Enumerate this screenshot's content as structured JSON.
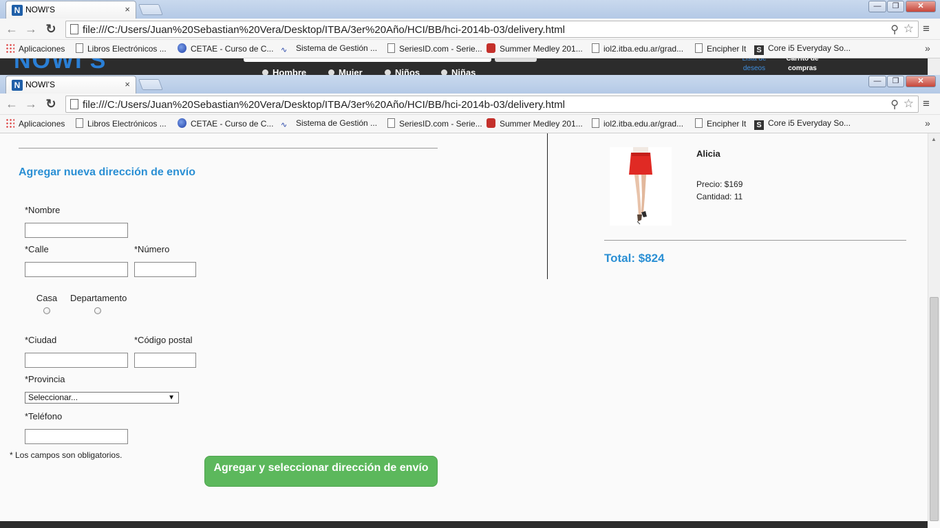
{
  "browser": {
    "tab_title": "NOWI'S",
    "tab_favicon_letter": "N",
    "tab_close": "×",
    "url": "file:///C:/Users/Juan%20Sebastian%20Vera/Desktop/ITBA/3er%20Año/HCI/BB/hci-2014b-03/delivery.html",
    "menu_glyph": "≡",
    "bookmarks": [
      {
        "label": "Aplicaciones",
        "icon": "apps-icon"
      },
      {
        "label": "Libros Electrónicos ...",
        "icon": "page-icon"
      },
      {
        "label": "CETAE - Curso de C...",
        "icon": "globe-icon"
      },
      {
        "label": "Sistema de Gestión ...",
        "icon": "wave-icon"
      },
      {
        "label": "SeriesID.com - Serie...",
        "icon": "page-icon"
      },
      {
        "label": "Summer Medley 201...",
        "icon": "youtube-icon"
      },
      {
        "label": "iol2.itba.edu.ar/grad...",
        "icon": "page-icon"
      },
      {
        "label": "Encipher It",
        "icon": "page-icon"
      },
      {
        "label": "Core i5 Everyday So...",
        "icon": "s-icon"
      }
    ],
    "bookmarks_more": "»"
  },
  "site_header": {
    "categories": [
      "Hombre",
      "Mujer",
      "Niños",
      "Niñas"
    ],
    "wishlist": "Lista de deseos",
    "cart": "Carrito de compras"
  },
  "form": {
    "title": "Agregar nueva dirección de envío",
    "labels": {
      "nombre": "*Nombre",
      "calle": "*Calle",
      "numero": "*Número",
      "casa": "Casa",
      "departamento": "Departamento",
      "ciudad": "*Ciudad",
      "codigo_postal": "*Código postal",
      "provincia": "*Provincia",
      "telefono": "*Teléfono"
    },
    "provincia_selected": "Seleccionar...",
    "required_note": "* Los campos son obligatorios.",
    "submit_label": "Agregar y seleccionar dirección de envío"
  },
  "order": {
    "product_name": "Alicia",
    "price": "Precio: $169",
    "quantity": "Cantidad: 11",
    "total": "Total: $824"
  }
}
